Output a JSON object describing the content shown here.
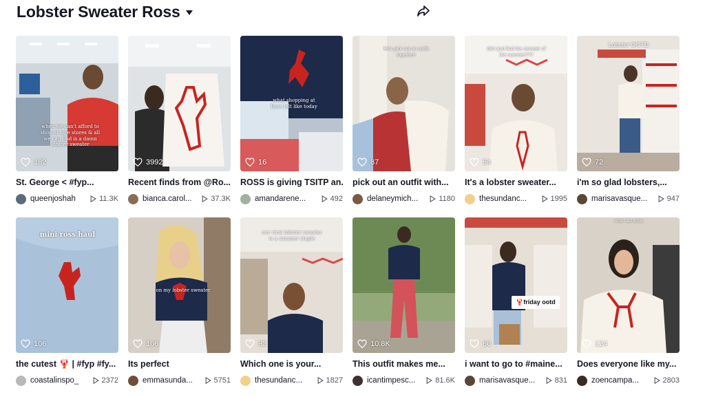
{
  "header": {
    "title": "Lobster Sweater Ross",
    "share_icon": "share-icon",
    "dropdown_icon": "caret-down-icon"
  },
  "videos": [
    {
      "likes": "182",
      "caption": "St. George < #fyp...",
      "user": "queenjoshah",
      "views": "11.3K",
      "overlay": "when we can't afford to shop at nice stores & all we can find is a damn lobster sweater"
    },
    {
      "likes": "3992",
      "caption": "Recent finds from @Ro...",
      "user": "bianca.carol...",
      "views": "37.3K",
      "overlay": ""
    },
    {
      "likes": "16",
      "caption": "ROSS is giving TSITP an...",
      "user": "amandarene...",
      "views": "492",
      "overlay": "what shopping at Ross felt like today"
    },
    {
      "likes": "87",
      "caption": "pick out an outfit with...",
      "user": "delaneymich...",
      "views": "1180",
      "overlay": "let's pick out an outfit together!"
    },
    {
      "likes": "54",
      "caption": "It's a lobster sweater...",
      "user": "thesundanc...",
      "views": "1995",
      "overlay": "did I just find the sweater of the summer???"
    },
    {
      "likes": "72",
      "caption": "i'm so glad lobsters,...",
      "user": "marisavasque...",
      "views": "947",
      "overlay": "Lobster OOTD"
    },
    {
      "likes": "106",
      "caption": "the cutest 🦞 | #fyp #fy...",
      "user": "coastalinspo_",
      "views": "2372",
      "overlay": "mini ross haul"
    },
    {
      "likes": "106",
      "caption": "Its perfect",
      "user": "emmasunda...",
      "views": "5751",
      "overlay": "on my lobster sweater"
    },
    {
      "likes": "92",
      "caption": "Which one is your...",
      "user": "thesundanc...",
      "views": "1827",
      "overlay": "our viral lobster sweater is a summer staple"
    },
    {
      "likes": "10.8K",
      "caption": "This outfit makes me...",
      "user": "icantimpesc...",
      "views": "81.6K",
      "overlay": ""
    },
    {
      "likes": "60",
      "caption": "i want to go to #maine...",
      "user": "marisavasque...",
      "views": "831",
      "overlay": "🦞friday ootd"
    },
    {
      "likes": "124",
      "caption": "Does everyone like my...",
      "user": "zoencampa...",
      "views": "2803",
      "overlay": "what I ate today"
    }
  ],
  "colors": {
    "lobster_red": "#c8241f",
    "navy": "#1d2a4a",
    "text": "#161823"
  }
}
